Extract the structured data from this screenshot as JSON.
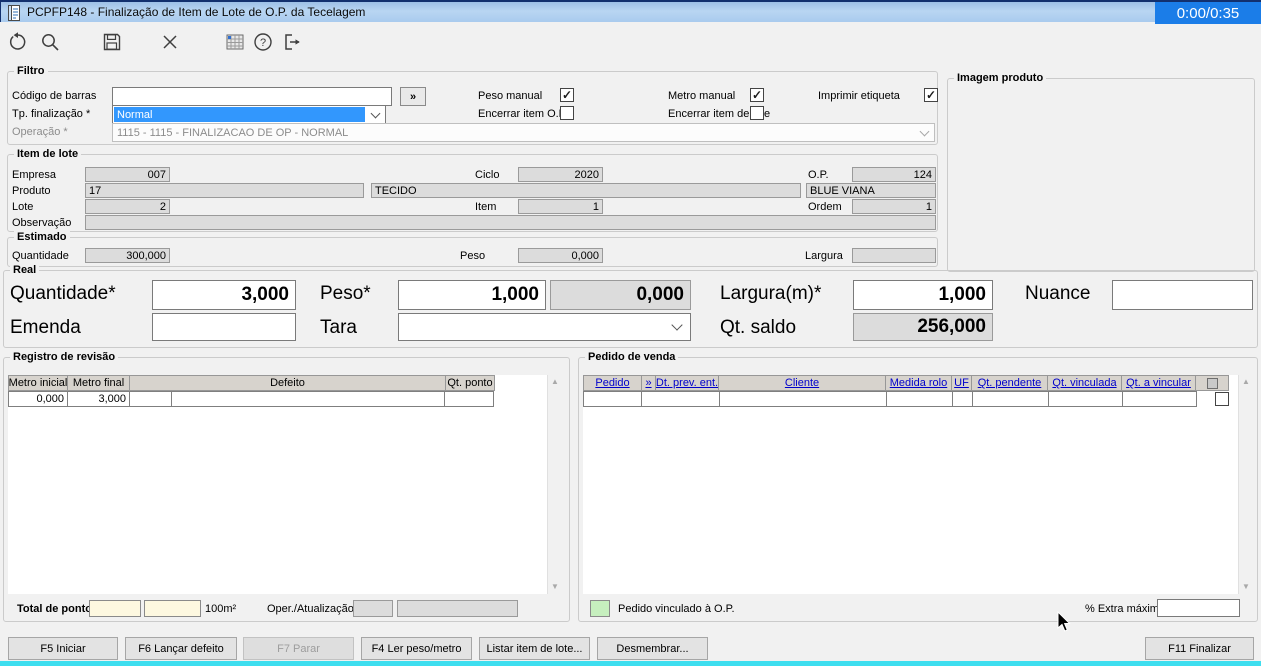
{
  "window": {
    "title": "PCPFP148 - Finalização de Item de Lote de O.P. da Tecelagem",
    "timer": "0:00/0:35"
  },
  "toolbar": {
    "icons": [
      "refresh",
      "search",
      "save",
      "close",
      "grid",
      "help",
      "exit"
    ]
  },
  "filtro": {
    "title": "Filtro",
    "codigo_de_barras": {
      "label": "Código de barras",
      "value": "",
      "more_button": "»"
    },
    "tp_finalizacao": {
      "label": "Tp. finalização *",
      "value": "Normal"
    },
    "operacao": {
      "label": "Operação *",
      "value": "1115 - 1115 - FINALIZACAO DE OP - NORMAL"
    },
    "peso_manual": {
      "label": "Peso manual",
      "checked": true
    },
    "metro_manual": {
      "label": "Metro manual",
      "checked": true
    },
    "imprimir_etiqueta": {
      "label": "Imprimir etiqueta",
      "checked": true
    },
    "encerrar_item_op": {
      "label": "Encerrar item O.P.",
      "checked": false
    },
    "encerrar_item_lote": {
      "label": "Encerrar item de lote",
      "checked": false
    }
  },
  "imagem_produto": {
    "title": "Imagem produto"
  },
  "item_de_lote": {
    "title": "Item de lote",
    "empresa": {
      "label": "Empresa",
      "value": "007"
    },
    "ciclo": {
      "label": "Ciclo",
      "value": "2020"
    },
    "op": {
      "label": "O.P.",
      "value": "124"
    },
    "produto": {
      "label": "Produto",
      "codigo": "17",
      "descricao": "TECIDO",
      "complemento": "BLUE VIANA"
    },
    "lote": {
      "label": "Lote",
      "value": "2"
    },
    "item": {
      "label": "Item",
      "value": "1"
    },
    "ordem": {
      "label": "Ordem",
      "value": "1"
    },
    "observacao": {
      "label": "Observação",
      "value": ""
    }
  },
  "estimado": {
    "title": "Estimado",
    "quantidade": {
      "label": "Quantidade",
      "value": "300,000"
    },
    "peso": {
      "label": "Peso",
      "value": "0,000"
    },
    "largura": {
      "label": "Largura",
      "value": ""
    }
  },
  "real": {
    "title": "Real",
    "quantidade": {
      "label": "Quantidade*",
      "value": "3,000"
    },
    "emenda": {
      "label": "Emenda",
      "value": ""
    },
    "peso": {
      "label": "Peso*",
      "value": "1,000",
      "value_calculado": "0,000"
    },
    "tara": {
      "label": "Tara",
      "value": ""
    },
    "largura": {
      "label": "Largura(m)*",
      "value": "1,000"
    },
    "qt_saldo": {
      "label": "Qt. saldo",
      "value": "256,000"
    },
    "nuance": {
      "label": "Nuance",
      "value": ""
    }
  },
  "registro_revisao": {
    "title": "Registro de revisão",
    "headers": [
      "Metro inicial",
      "Metro final",
      "Defeito",
      "Qt. ponto"
    ],
    "rows": [
      {
        "metro_inicial": "0,000",
        "metro_final": "3,000",
        "defeito_codigo": "",
        "defeito_descricao": "",
        "qt_ponto": ""
      }
    ],
    "total_de_ponto": {
      "label": "Total de ponto",
      "value1": "",
      "value2": "",
      "unidade": "100m²"
    },
    "oper_atualizacao": {
      "label": "Oper./Atualização",
      "value1": "",
      "value2": ""
    }
  },
  "pedido_venda": {
    "title": "Pedido de venda",
    "headers": [
      "Pedido",
      "»",
      "Dt. prev. ent.",
      "Cliente",
      "Medida rolo",
      "UF",
      "Qt. pendente",
      "Qt. vinculada",
      "Qt. a vincular"
    ],
    "rows": [
      {
        "pedido": "",
        "dt_prev_ent": "",
        "cliente": "",
        "medida_rolo": "",
        "uf": "",
        "qt_pendente": "",
        "qt_vinculada": "",
        "qt_a_vincular": "",
        "checked": false
      }
    ],
    "legenda": {
      "label": "Pedido vinculado à O.P.",
      "cor": "#c6efbe"
    },
    "extra_maximo": {
      "label": "% Extra máximo",
      "value": ""
    }
  },
  "footer_buttons": [
    {
      "label": "F5 Iniciar",
      "enabled": true
    },
    {
      "label": "F6 Lançar defeito",
      "enabled": true
    },
    {
      "label": "F7 Parar",
      "enabled": false
    },
    {
      "label": "F4 Ler peso/metro",
      "enabled": true
    },
    {
      "label": "Listar item de lote...",
      "enabled": true
    },
    {
      "label": "Desmembrar...",
      "enabled": true
    },
    {
      "label": "F11 Finalizar",
      "enabled": true
    }
  ],
  "colors": {
    "titlebar_blue": "#a9cbee",
    "timer_bg": "#1b7de8",
    "selection_blue": "#3297fd",
    "header_link_blue": "#0000cc",
    "cream_field": "#fdf8e0",
    "linked_green": "#c6efbe",
    "bottom_bar_cyan": "#3edeef"
  }
}
